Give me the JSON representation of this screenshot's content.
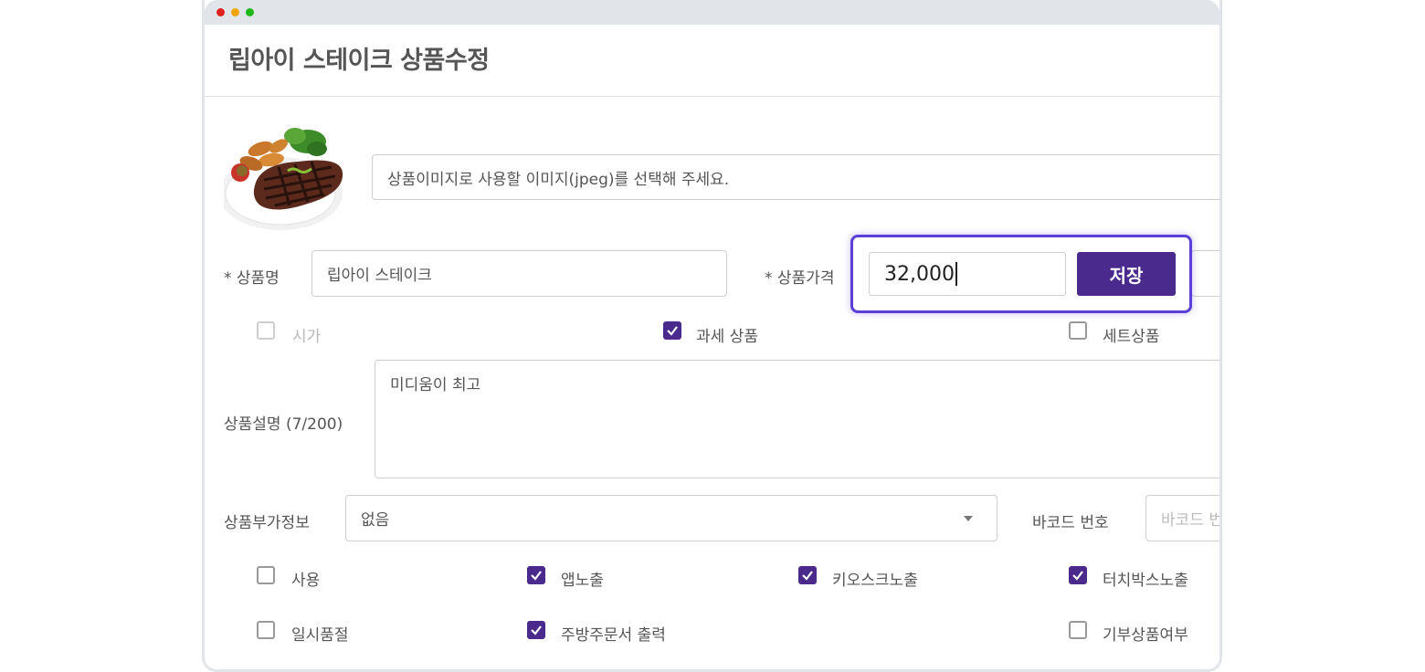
{
  "page": {
    "title": "립아이 스테이크 상품수정"
  },
  "image": {
    "alt": "립아이 스테이크",
    "placeholder": "상품이미지로 사용할 이미지(jpeg)를 선택해 주세요."
  },
  "name": {
    "label": "* 상품명",
    "value": "립아이 스테이크"
  },
  "price": {
    "label": "* 상품가격",
    "value": "32,000",
    "save_label": "저장"
  },
  "options_row1": [
    {
      "label": "시가",
      "checked": false,
      "disabled": true
    },
    {
      "label": "과세 상품",
      "checked": true,
      "disabled": false
    },
    {
      "label": "세트상품",
      "checked": false,
      "disabled": false
    }
  ],
  "description": {
    "label": "상품설명 (7/200)",
    "value": "미디움이 최고"
  },
  "extra_info": {
    "label": "상품부가정보",
    "selected": "없음"
  },
  "barcode": {
    "label": "바코드 번호",
    "placeholder": "바코드 번호"
  },
  "options_row2": [
    {
      "label": "사용",
      "checked": false
    },
    {
      "label": "앱노출",
      "checked": true
    },
    {
      "label": "키오스크노출",
      "checked": true
    },
    {
      "label": "터치박스노출",
      "checked": true
    }
  ],
  "options_row3": [
    {
      "label": "일시품절",
      "checked": false
    },
    {
      "label": "주방주문서 출력",
      "checked": true
    },
    {
      "label": "기부상품여부",
      "checked": false
    }
  ],
  "colors": {
    "accent": "#4b2a8e",
    "focus_border": "#5b3fd6"
  }
}
